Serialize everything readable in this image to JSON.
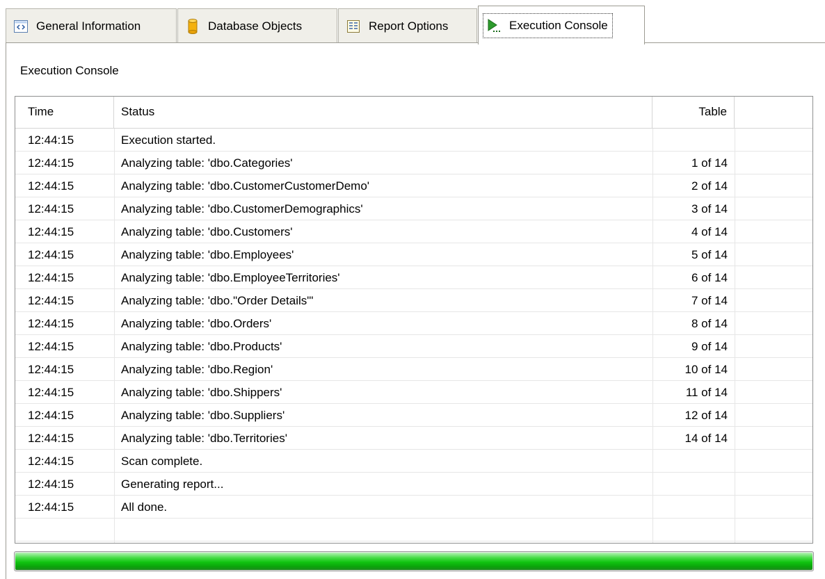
{
  "tabs": [
    {
      "label": "General Information",
      "icon": "code-brackets-icon"
    },
    {
      "label": "Database Objects",
      "icon": "database-cylinder-icon"
    },
    {
      "label": "Report Options",
      "icon": "report-grid-icon"
    },
    {
      "label": "Execution Console",
      "icon": "play-console-icon",
      "active": true
    }
  ],
  "panel": {
    "title": "Execution Console"
  },
  "columns": {
    "time": "Time",
    "status": "Status",
    "table": "Table"
  },
  "rows": [
    {
      "time": "12:44:15",
      "status": "Execution started.",
      "table": ""
    },
    {
      "time": "12:44:15",
      "status": "Analyzing table: 'dbo.Categories'",
      "table": "1 of 14"
    },
    {
      "time": "12:44:15",
      "status": "Analyzing table: 'dbo.CustomerCustomerDemo'",
      "table": "2 of 14"
    },
    {
      "time": "12:44:15",
      "status": "Analyzing table: 'dbo.CustomerDemographics'",
      "table": "3 of 14"
    },
    {
      "time": "12:44:15",
      "status": "Analyzing table: 'dbo.Customers'",
      "table": "4 of 14"
    },
    {
      "time": "12:44:15",
      "status": "Analyzing table: 'dbo.Employees'",
      "table": "5 of 14"
    },
    {
      "time": "12:44:15",
      "status": "Analyzing table: 'dbo.EmployeeTerritories'",
      "table": "6 of 14"
    },
    {
      "time": "12:44:15",
      "status": "Analyzing table: 'dbo.\"Order Details\"'",
      "table": "7 of 14"
    },
    {
      "time": "12:44:15",
      "status": "Analyzing table: 'dbo.Orders'",
      "table": "8 of 14"
    },
    {
      "time": "12:44:15",
      "status": "Analyzing table: 'dbo.Products'",
      "table": "9 of 14"
    },
    {
      "time": "12:44:15",
      "status": "Analyzing table: 'dbo.Region'",
      "table": "10 of 14"
    },
    {
      "time": "12:44:15",
      "status": "Analyzing table: 'dbo.Shippers'",
      "table": "11 of 14"
    },
    {
      "time": "12:44:15",
      "status": "Analyzing table: 'dbo.Suppliers'",
      "table": "12 of 14"
    },
    {
      "time": "12:44:15",
      "status": "Analyzing table: 'dbo.Territories'",
      "table": "14 of 14"
    },
    {
      "time": "12:44:15",
      "status": "Scan complete.",
      "table": ""
    },
    {
      "time": "12:44:15",
      "status": "Generating report...",
      "table": ""
    },
    {
      "time": "12:44:15",
      "status": "All done.",
      "table": ""
    }
  ],
  "progress": {
    "percent": 100,
    "color": "#11c411"
  }
}
